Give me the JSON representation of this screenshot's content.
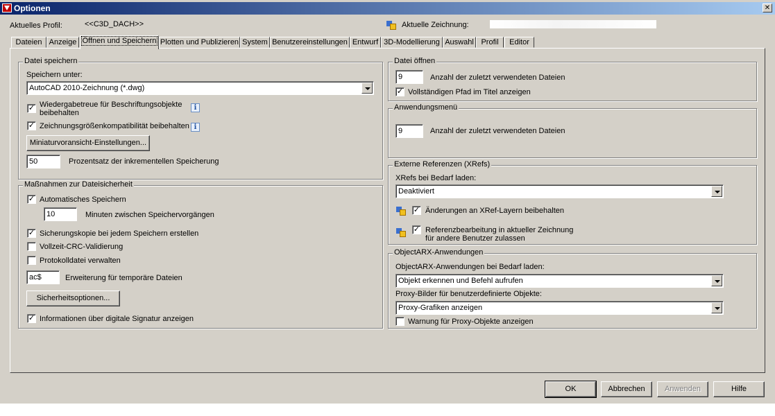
{
  "window": {
    "title": "Optionen",
    "close_glyph": "✕"
  },
  "header": {
    "profile_label": "Aktuelles Profil:",
    "profile_value": "<<C3D_DACH>>",
    "drawing_label": "Aktuelle Zeichnung:",
    "drawing_value": ""
  },
  "tabs": [
    "Dateien",
    "Anzeige",
    "Öffnen und Speichern",
    "Plotten und Publizieren",
    "System",
    "Benutzereinstellungen",
    "Entwurf",
    "3D-Modellierung",
    "Auswahl",
    "Profil",
    "Editor"
  ],
  "active_tab": "Öffnen und Speichern",
  "save_group": {
    "title": "Datei speichern",
    "save_as_label": "Speichern unter:",
    "save_as_value": "AutoCAD 2010-Zeichnung (*.dwg)",
    "annot_fidelity_line1": "Wiedergabetreue für Beschriftungsobjekte",
    "annot_fidelity_line2": "beibehalten",
    "annot_fidelity_checked": true,
    "size_compat_label": "Zeichnungsgrößenkompatibilität beibehalten",
    "size_compat_checked": true,
    "thumbnail_button": "Miniaturvoransicht-Einstellungen...",
    "incremental_value": "50",
    "incremental_label": "Prozentsatz der inkrementellen Speicherung",
    "check_mark": "✓",
    "info_glyph": "i"
  },
  "safety_group": {
    "title": "Maßnahmen zur Dateisicherheit",
    "autosave_label": "Automatisches Speichern",
    "autosave_checked": true,
    "minutes_value": "10",
    "minutes_label": "Minuten zwischen Speichervorgängen",
    "backup_label": "Sicherungskopie bei jedem Speichern erstellen",
    "backup_checked": true,
    "crc_label": "Vollzeit-CRC-Validierung",
    "crc_checked": false,
    "log_label": "Protokolldatei verwalten",
    "log_checked": false,
    "temp_ext_value": "ac$",
    "temp_ext_label": "Erweiterung für temporäre Dateien",
    "security_button": "Sicherheitsoptionen...",
    "signature_label": "Informationen über digitale Signatur anzeigen",
    "signature_checked": true
  },
  "open_group": {
    "title": "Datei öffnen",
    "recent_value": "9",
    "recent_label": "Anzahl der zuletzt verwendeten Dateien",
    "fullpath_label": "Vollständigen Pfad im Titel anzeigen",
    "fullpath_checked": true
  },
  "appmenu_group": {
    "title": "Anwendungsmenü",
    "recent_value": "9",
    "recent_label": "Anzahl der zuletzt verwendeten Dateien"
  },
  "xref_group": {
    "title": "Externe Referenzen (XRefs)",
    "demand_label": "XRefs bei Bedarf laden:",
    "demand_value": "Deaktiviert",
    "layer_changes_label": "Änderungen an XRef-Layern beibehalten",
    "layer_changes_checked": true,
    "refedit_line1": "Referenzbearbeitung in aktueller Zeichnung",
    "refedit_line2": "für andere Benutzer zulassen",
    "refedit_checked": true
  },
  "arx_group": {
    "title": "ObjectARX-Anwendungen",
    "demand_label": "ObjectARX-Anwendungen bei Bedarf laden:",
    "demand_value": "Objekt erkennen und Befehl aufrufen",
    "proxy_label": "Proxy-Bilder für benutzerdefinierte Objekte:",
    "proxy_value": "Proxy-Grafiken anzeigen",
    "proxy_warning_label": "Warnung für Proxy-Objekte anzeigen",
    "proxy_warning_checked": false
  },
  "buttons": {
    "ok": "OK",
    "cancel": "Abbrechen",
    "apply": "Anwenden",
    "help": "Hilfe"
  },
  "colors": {
    "dialog_bg": "#d4d0c8",
    "title_start": "#0a246a",
    "title_end": "#a6caf0"
  }
}
